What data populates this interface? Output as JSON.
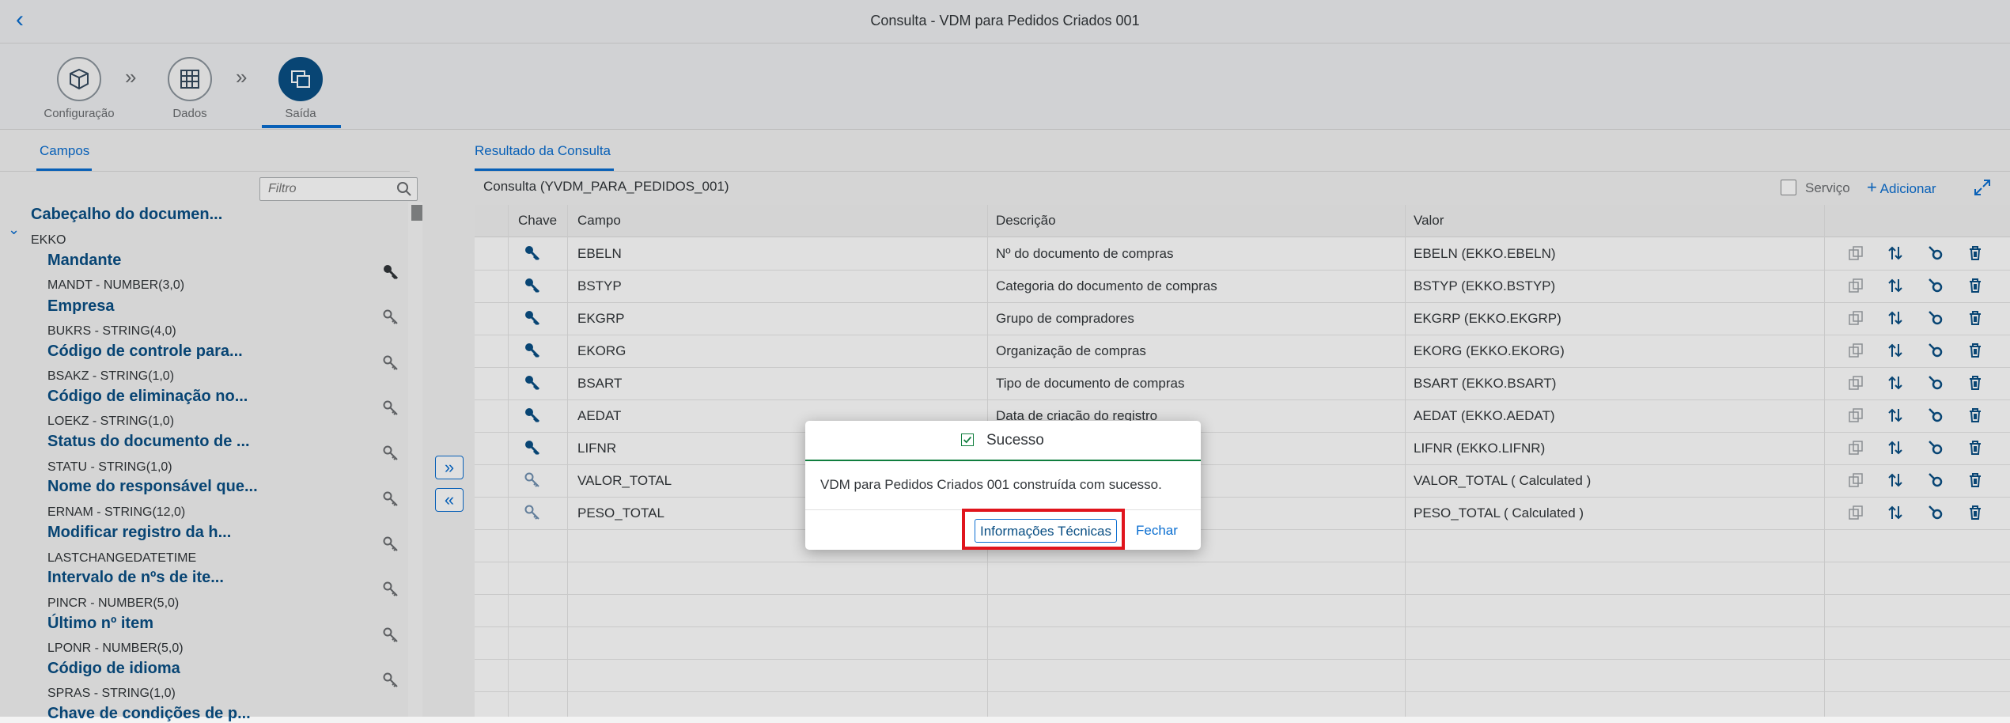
{
  "app": {
    "title": "Consulta - VDM para Pedidos Criados 001"
  },
  "wizard": {
    "steps": [
      {
        "label": "Configuração",
        "icon": "box-cube-icon"
      },
      {
        "label": "Dados",
        "icon": "table-grid-icon"
      },
      {
        "label": "Saída",
        "icon": "output-copy-icon"
      }
    ],
    "active_step": 2
  },
  "left": {
    "tab": "Campos",
    "filter_placeholder": "Filtro",
    "group": {
      "title": "Cabeçalho do documen...",
      "subtitle": "EKKO"
    },
    "fields": [
      {
        "name": "Mandante",
        "type": "MANDT - NUMBER(3,0)",
        "key": true
      },
      {
        "name": "Empresa",
        "type": "BUKRS - STRING(4,0)",
        "key": false
      },
      {
        "name": "Código de controle para...",
        "type": "BSAKZ - STRING(1,0)",
        "key": false
      },
      {
        "name": "Código de eliminação no...",
        "type": "LOEKZ - STRING(1,0)",
        "key": false
      },
      {
        "name": "Status do documento de ...",
        "type": "STATU - STRING(1,0)",
        "key": false
      },
      {
        "name": "Nome do responsável que...",
        "type": "ERNAM - STRING(12,0)",
        "key": false
      },
      {
        "name": "Modificar registro da h...",
        "type": "LASTCHANGEDATETIME",
        "key": false
      },
      {
        "name": "Intervalo de nºs de ite...",
        "type": "PINCR - NUMBER(5,0)",
        "key": false
      },
      {
        "name": "Último nº item",
        "type": "LPONR - NUMBER(5,0)",
        "key": false
      },
      {
        "name": "Código de idioma",
        "type": "SPRAS - STRING(1,0)",
        "key": false
      },
      {
        "name": "Chave de condições de p...",
        "type": "",
        "key": false
      }
    ]
  },
  "right": {
    "tab": "Resultado da Consulta",
    "query_title": "Consulta (YVDM_PARA_PEDIDOS_001)",
    "servico_label": "Serviço",
    "add_label": "Adicionar",
    "columns": [
      "Chave",
      "Campo",
      "Descrição",
      "Valor"
    ],
    "rows": [
      {
        "key": "strong",
        "campo": "EBELN",
        "descricao": "Nº do documento de compras",
        "valor": "EBELN (EKKO.EBELN)"
      },
      {
        "key": "strong",
        "campo": "BSTYP",
        "descricao": "Categoria do documento de compras",
        "valor": "BSTYP (EKKO.BSTYP)"
      },
      {
        "key": "strong",
        "campo": "EKGRP",
        "descricao": "Grupo de compradores",
        "valor": "EKGRP (EKKO.EKGRP)"
      },
      {
        "key": "strong",
        "campo": "EKORG",
        "descricao": "Organização de compras",
        "valor": "EKORG (EKKO.EKORG)"
      },
      {
        "key": "strong",
        "campo": "BSART",
        "descricao": "Tipo de documento de compras",
        "valor": "BSART (EKKO.BSART)"
      },
      {
        "key": "strong",
        "campo": "AEDAT",
        "descricao": "Data de criação do registro",
        "valor": "AEDAT (EKKO.AEDAT)"
      },
      {
        "key": "strong",
        "campo": "LIFNR",
        "descricao": "",
        "valor": "LIFNR (EKKO.LIFNR)"
      },
      {
        "key": "light",
        "campo": "VALOR_TOTAL",
        "descricao": "",
        "valor": "VALOR_TOTAL ( Calculated )"
      },
      {
        "key": "light",
        "campo": "PESO_TOTAL",
        "descricao": "",
        "valor": "PESO_TOTAL ( Calculated )"
      }
    ]
  },
  "dialog": {
    "title": "Sucesso",
    "message": "VDM para Pedidos Criados 001 construída com sucesso.",
    "tech_button": "Informações Técnicas",
    "close_button": "Fechar"
  },
  "colors": {
    "brand": "#0a6ed1",
    "dark_blue": "#0a4f84",
    "success": "#107e3e",
    "highlight": "#e0151d"
  }
}
